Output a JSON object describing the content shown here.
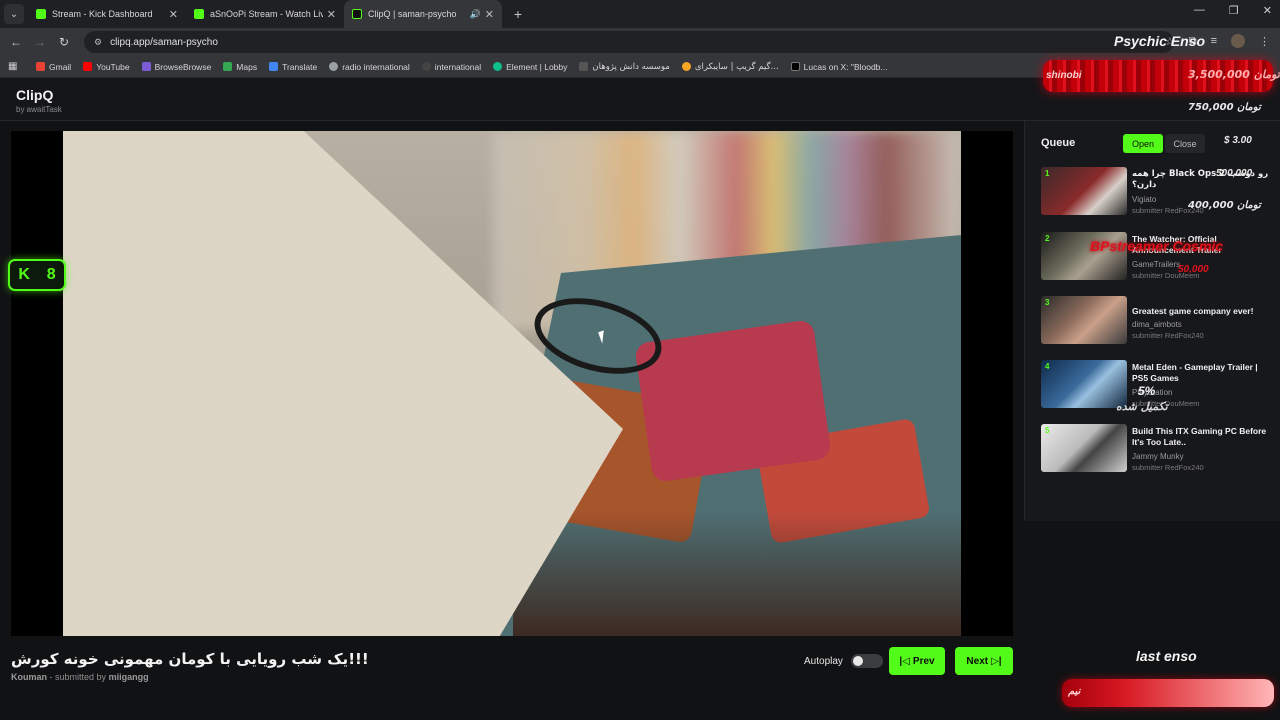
{
  "browser": {
    "tabs": [
      {
        "title": "Stream - Kick Dashboard",
        "icon": "kick-favicon",
        "color": "#53fc18"
      },
      {
        "title": "aSnOoPi Stream - Watch Live o",
        "icon": "kick-favicon",
        "color": "#53fc18"
      },
      {
        "title": "ClipQ | saman-psycho",
        "icon": "play-favicon",
        "color": "#53fc18",
        "active": true
      }
    ],
    "url": "clipq.app/saman-psycho",
    "bookmarks": [
      {
        "label": "Gmail",
        "color": "#ea4335"
      },
      {
        "label": "YouTube",
        "color": "#ff0000"
      },
      {
        "label": "BrowseBrowse",
        "color": "#7b5cd6"
      },
      {
        "label": "Maps",
        "color": "#34a853"
      },
      {
        "label": "Translate",
        "color": "#4285f4"
      },
      {
        "label": "radio international",
        "color": "#9aa0a6"
      },
      {
        "label": "international",
        "color": "#444"
      },
      {
        "label": "Element | Lobby",
        "color": "#0dbd8b"
      },
      {
        "label": "موسسه دانش پژوهان",
        "color": "#555"
      },
      {
        "label": "گیم گریپ | سایبکرای...",
        "color": "#f5a623"
      },
      {
        "label": "Lucas on X: \"Bloodb...",
        "color": "#000"
      }
    ]
  },
  "app": {
    "name": "ClipQ",
    "byline": "by awaitTask"
  },
  "player": {
    "kick_badge_count": "8",
    "title": "یک شب رویایی با کومان مهمونی خونه کورش!!!",
    "channel": "Kouman",
    "submitted_by_label": "- submitted by",
    "submitter": "miigangg",
    "autoplay_label": "Autoplay",
    "prev_label": "Prev",
    "next_label": "Next"
  },
  "queue": {
    "title": "Queue",
    "open_label": "Open",
    "close_label": "Close",
    "items": [
      {
        "num": "1",
        "title": "چرا همه Black Ops 2 رو دوست دارن؟",
        "channel": "Vigiato",
        "submitter": "submitter RedFox240"
      },
      {
        "num": "2",
        "title": "The Watcher: Official Announcement Trailer",
        "channel": "GameTrailers",
        "submitter": "submitter DouMeem"
      },
      {
        "num": "3",
        "title": "Greatest game company ever!",
        "channel": "dima_aimbots",
        "submitter": "submitter RedFox240"
      },
      {
        "num": "4",
        "title": "Metal Eden - Gameplay Trailer | PS5 Games",
        "channel": "PlayStation",
        "submitter": "submitter DouMeem"
      },
      {
        "num": "5",
        "title": "Build This ITX Gaming PC Before It's Too Late..",
        "channel": "Jammy Munky",
        "submitter": "submitter RedFox240"
      }
    ]
  },
  "overlay": {
    "heading": "Psychic Enso",
    "donor1": "shinobi",
    "amount1": "3,500,000 تومان",
    "amount2": "750,000 تومان",
    "dollar": "$ 3.00",
    "amount3": "500,000",
    "amount4": "400,000 تومان",
    "overlay_tag": "BPstreamer Cosmic",
    "amount5": "50,000",
    "percent": "5%",
    "percent_label": "تکمیل شده",
    "last_label": "last enso",
    "last_donor": "نیم"
  }
}
